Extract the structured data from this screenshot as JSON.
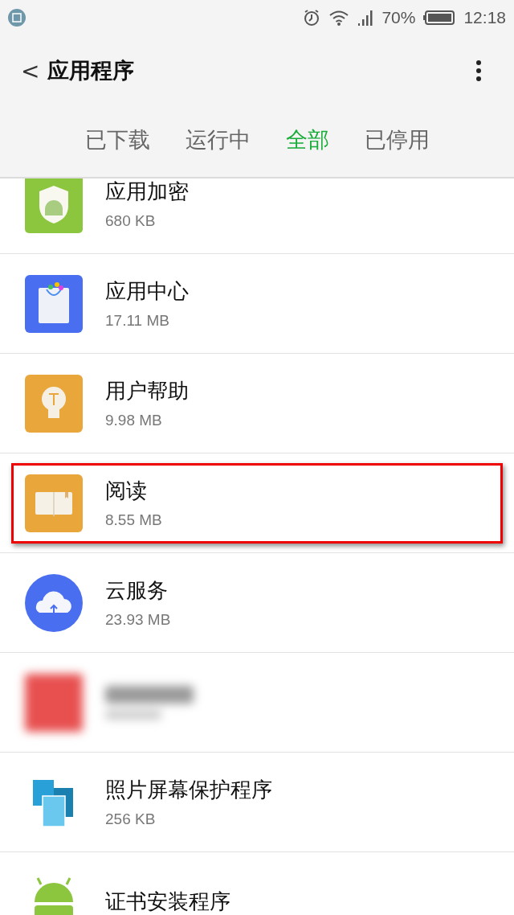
{
  "status_bar": {
    "battery": "70%",
    "time": "12:18"
  },
  "header": {
    "back": "<",
    "title": "应用程序"
  },
  "tabs": [
    {
      "label": "已下载",
      "selected": false
    },
    {
      "label": "运行中",
      "selected": false
    },
    {
      "label": "全部",
      "selected": true
    },
    {
      "label": "已停用",
      "selected": false
    }
  ],
  "apps": [
    {
      "kind": "app",
      "name": "应用加密",
      "size": "680 KB",
      "highlighted": false
    },
    {
      "kind": "app",
      "name": "应用中心",
      "size": "17.11 MB",
      "highlighted": false
    },
    {
      "kind": "app",
      "name": "用户帮助",
      "size": "9.98 MB",
      "highlighted": false
    },
    {
      "kind": "app",
      "name": "阅读",
      "size": "8.55 MB",
      "highlighted": true
    },
    {
      "kind": "app",
      "name": "云服务",
      "size": "23.93 MB",
      "highlighted": false
    },
    {
      "kind": "blurred",
      "highlighted": false
    },
    {
      "kind": "app",
      "name": "照片屏幕保护程序",
      "size": "256 KB",
      "highlighted": false
    },
    {
      "kind": "app",
      "name": "证书安装程序",
      "highlighted": false
    }
  ]
}
